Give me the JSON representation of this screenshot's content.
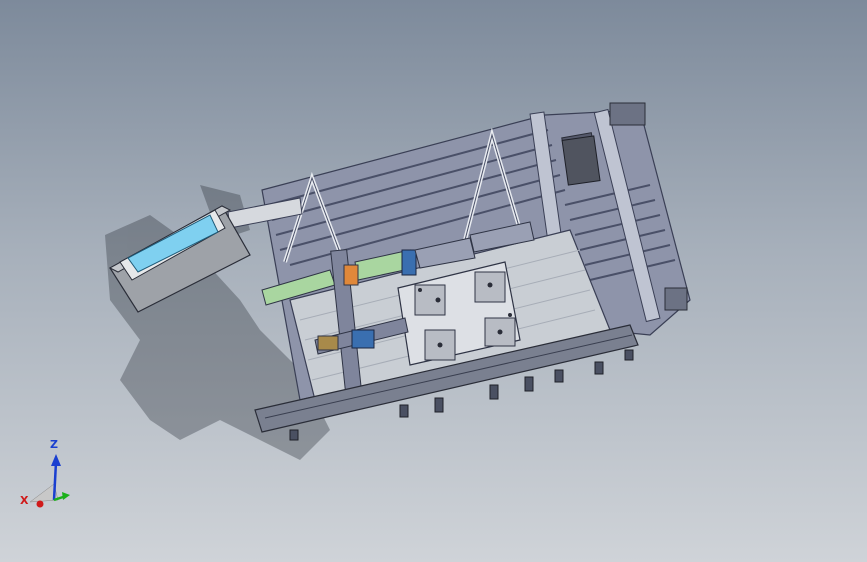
{
  "viewport": {
    "background_top": "#7d8a9b",
    "background_bottom": "#cfd3d8"
  },
  "model": {
    "frame_color": "#9aa0b4",
    "rail_color": "#7f859c",
    "plate_color": "#c9ced4",
    "screen_color": "#7fd0f0",
    "accent_green": "#a9d6a0",
    "accent_blue": "#3a6fb0",
    "accent_orange": "#e0883a"
  },
  "triad": {
    "z_label": "Z",
    "x_label": "X",
    "z_color": "#1a3fd0",
    "x_color": "#d01a1a",
    "y_color": "#1ab01a"
  }
}
